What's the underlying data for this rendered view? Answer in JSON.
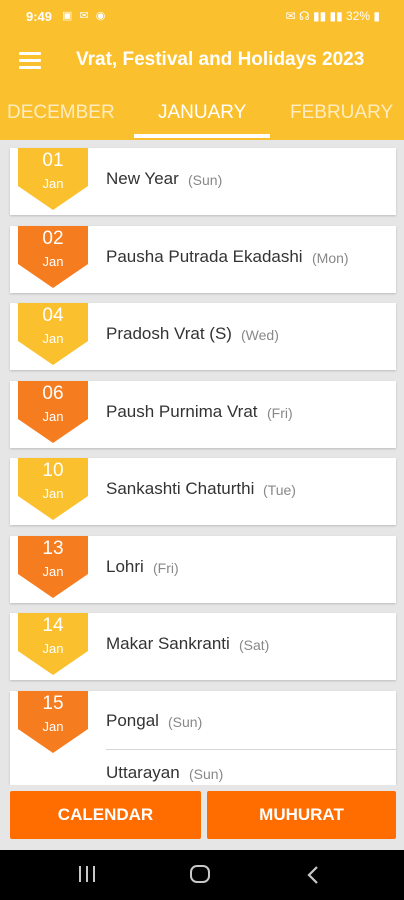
{
  "status_bar": {
    "time": "9:49",
    "left_icons": "▣ ✉ ◉",
    "right_text": "✉ ☊ ▮▮ ▮▮ 32% ▮"
  },
  "app_bar": {
    "menu_icon": "hamburger-menu-icon",
    "title": "Vrat, Festival and Holidays 2023"
  },
  "tabs": {
    "items": [
      "DECEMBER",
      "JANUARY",
      "FEBRUARY"
    ],
    "selected": "JANUARY"
  },
  "colors": {
    "primary": "#fbc02d",
    "accent": "#ff6d00",
    "badge_yellow": "#fbc02d",
    "badge_orange": "#f57c1f"
  },
  "events": [
    {
      "day": "01",
      "month": "Jan",
      "badge_color": "yellow",
      "items": [
        {
          "name": "New Year",
          "weekday": "(Sun)"
        }
      ]
    },
    {
      "day": "02",
      "month": "Jan",
      "badge_color": "orange",
      "items": [
        {
          "name": "Pausha Putrada Ekadashi",
          "weekday": "(Mon)"
        }
      ]
    },
    {
      "day": "04",
      "month": "Jan",
      "badge_color": "yellow",
      "items": [
        {
          "name": "Pradosh Vrat (S)",
          "weekday": "(Wed)"
        }
      ]
    },
    {
      "day": "06",
      "month": "Jan",
      "badge_color": "orange",
      "items": [
        {
          "name": "Paush Purnima Vrat",
          "weekday": "(Fri)"
        }
      ]
    },
    {
      "day": "10",
      "month": "Jan",
      "badge_color": "yellow",
      "items": [
        {
          "name": "Sankashti Chaturthi",
          "weekday": "(Tue)"
        }
      ]
    },
    {
      "day": "13",
      "month": "Jan",
      "badge_color": "orange",
      "items": [
        {
          "name": "Lohri",
          "weekday": "(Fri)"
        }
      ]
    },
    {
      "day": "14",
      "month": "Jan",
      "badge_color": "yellow",
      "items": [
        {
          "name": "Makar Sankranti",
          "weekday": "(Sat)"
        }
      ]
    },
    {
      "day": "15",
      "month": "Jan",
      "badge_color": "orange",
      "items": [
        {
          "name": "Pongal",
          "weekday": "(Sun)"
        },
        {
          "name": "Uttarayan",
          "weekday": "(Sun)"
        }
      ]
    }
  ],
  "buttons": {
    "calendar": "CALENDAR",
    "muhurat": "MUHURAT"
  },
  "nav_bar": {
    "recent_icon": "recent-apps-icon",
    "home_icon": "home-icon",
    "back_icon": "back-icon"
  }
}
